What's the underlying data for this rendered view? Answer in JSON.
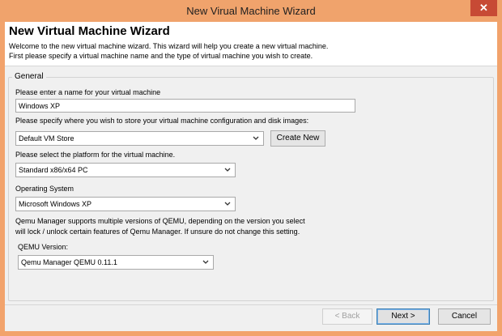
{
  "window": {
    "title": "New Virual Machine Wizard",
    "close_glyph": "✕"
  },
  "header": {
    "title": "New Virtual Machine Wizard",
    "line1": "Welcome to the new virtual machine wizard.  This wizard will help you create a new virtual machine.",
    "line2": "First please specify a virtual machine name and the type of virtual machine you wish to create."
  },
  "general": {
    "group_label": "General",
    "name_label": "Please enter a name for your virtual machine",
    "name_value": "Windows XP",
    "store_label": "Please specify where you wish to store your virtual machine configuration and disk images:",
    "store_value": "Default VM Store",
    "create_new_label": "Create New",
    "platform_label": "Please select the platform for the virtual machine.",
    "platform_value": "Standard x86/x64 PC",
    "os_label": "Operating System",
    "os_value": "Microsoft Windows XP",
    "qemu_note_line1": "Qemu Manager supports multiple versions of QEMU, depending on the version you select",
    "qemu_note_line2": "will lock / unlock certain features of Qemu Manager. If unsure do not change this setting.",
    "qemu_version_label": "QEMU Version:",
    "qemu_version_value": "Qemu Manager QEMU 0.11.1"
  },
  "footer": {
    "back_label": "< Back",
    "next_label": "Next >",
    "cancel_label": "Cancel"
  },
  "colors": {
    "titlebar": "#f0a36c",
    "close": "#c74a35"
  }
}
